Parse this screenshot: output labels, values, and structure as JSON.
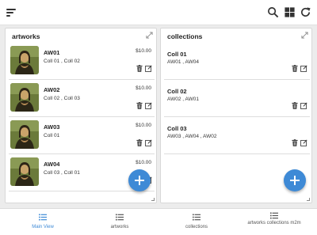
{
  "artworks_panel": {
    "title": "artworks",
    "items": [
      {
        "name": "AW01",
        "collections": "Coll 01 , Coll 02",
        "price": "$10.00"
      },
      {
        "name": "AW02",
        "collections": "Coll 02 , Coll 03",
        "price": "$10.00"
      },
      {
        "name": "AW03",
        "collections": "Coll 01",
        "price": "$10.00"
      },
      {
        "name": "AW04",
        "collections": "Coll 03 , Coll 01",
        "price": "$10.00"
      }
    ]
  },
  "collections_panel": {
    "title": "collections",
    "items": [
      {
        "name": "Coll 01",
        "artworks": "AW01 , AW04"
      },
      {
        "name": "Coll 02",
        "artworks": "AW02 , AW01"
      },
      {
        "name": "Coll 03",
        "artworks": "AW03 , AW04 , AW02"
      }
    ]
  },
  "bottom_nav": {
    "items": [
      {
        "label": "Main View",
        "active": true
      },
      {
        "label": "artworks"
      },
      {
        "label": "collections"
      },
      {
        "label": "artworks collections m2m"
      }
    ]
  },
  "icons": {
    "topbar": [
      "sort-menu-icon",
      "search-icon",
      "grid-icon",
      "refresh-icon"
    ],
    "item_actions": [
      "trash-icon",
      "edit-icon"
    ],
    "fab": "plus-icon"
  },
  "colors": {
    "accent": "#3e8ad6",
    "background": "#ececec"
  }
}
